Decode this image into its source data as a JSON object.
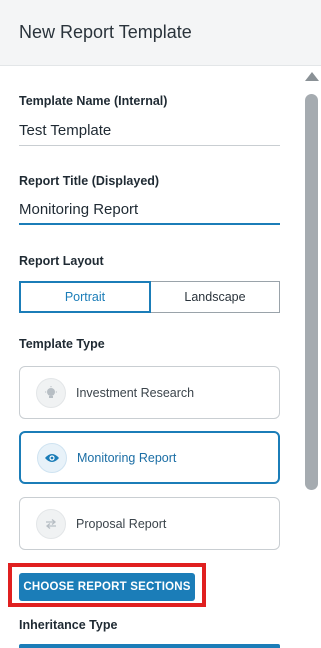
{
  "header": {
    "title": "New Report Template"
  },
  "form": {
    "template_name": {
      "label": "Template Name (Internal)",
      "value": "Test Template"
    },
    "report_title": {
      "label": "Report Title (Displayed)",
      "value": "Monitoring Report"
    },
    "layout": {
      "label": "Report Layout",
      "options": [
        "Portrait",
        "Landscape"
      ],
      "selected": "Portrait"
    },
    "template_type": {
      "label": "Template Type",
      "options": [
        {
          "label": "Investment Research",
          "icon": "lightbulb-icon"
        },
        {
          "label": "Monitoring Report",
          "icon": "eye-icon"
        },
        {
          "label": "Proposal Report",
          "icon": "swap-arrows-icon"
        }
      ],
      "selected": "Monitoring Report"
    },
    "choose_sections_label": "CHOOSE REPORT SECTIONS",
    "inheritance": {
      "label": "Inheritance Type"
    }
  },
  "colors": {
    "accent": "#1b7db8",
    "highlight": "#e02020"
  }
}
